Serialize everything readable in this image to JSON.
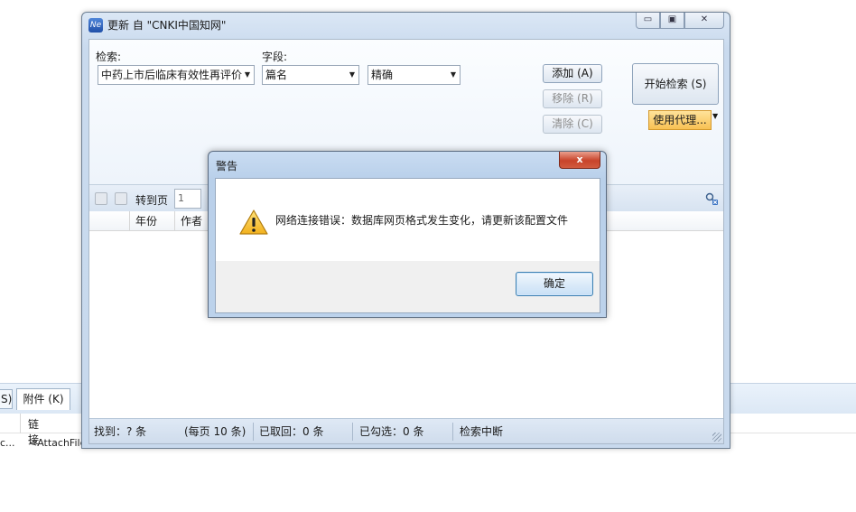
{
  "background": {
    "tab_left_label": "S)",
    "tab_attachments": "附件 (K)",
    "column_link": "链接",
    "row_left": "c...",
    "row_link": "<AttachFile"
  },
  "window": {
    "icon_text": "Ne",
    "title": "更新 自 \"CNKI中国知网\"",
    "min_glyph": "▭",
    "max_glyph": "▣",
    "close_glyph": "✕"
  },
  "search": {
    "query_label": "检索:",
    "query_value": "中药上市后临床有效性再评价",
    "field_label": "字段:",
    "field_value": "篇名",
    "match_value": "精确",
    "add_button": "添加 (A)",
    "remove_button": "移除 (R)",
    "clear_button": "清除 (C)",
    "start_button": "开始检索 (S)",
    "proxy_button": "使用代理..."
  },
  "pager": {
    "goto_label": "转到页",
    "page_value": "1"
  },
  "grid": {
    "columns": [
      "",
      "年份",
      "作者"
    ]
  },
  "status": {
    "found": "找到：? 条",
    "per_page": "(每页 10 条)",
    "fetched": "已取回：0 条",
    "checked": "已勾选：0 条",
    "state": "检索中断"
  },
  "dialog": {
    "title": "警告",
    "close_glyph": "x",
    "message": "网络连接错误：数据库网页格式发生变化，请更新该配置文件",
    "ok_button": "确定"
  },
  "colors": {
    "proxy_button": "#f8c153",
    "close_button": "#c8432a",
    "titlebar": "#c9daee"
  }
}
